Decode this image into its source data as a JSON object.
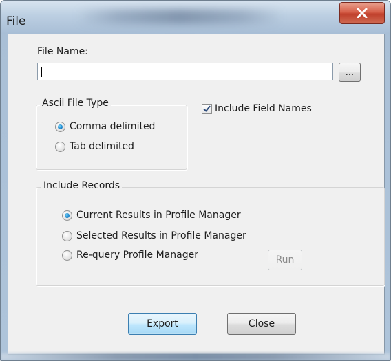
{
  "window": {
    "title": "File",
    "close_glyph": "X"
  },
  "file_name": {
    "label": "File Name:",
    "value": "",
    "browse_label": "..."
  },
  "ascii_file_type": {
    "label": "Ascii File Type",
    "options": [
      {
        "label": "Comma delimited",
        "selected": true
      },
      {
        "label": "Tab delimited",
        "selected": false
      }
    ]
  },
  "include_field_names": {
    "label": "Include Field Names",
    "checked": true
  },
  "include_records": {
    "label": "Include Records",
    "options": [
      {
        "label": "Current Results in Profile Manager",
        "selected": true
      },
      {
        "label": "Selected Results in Profile Manager",
        "selected": false
      },
      {
        "label": "Re-query Profile Manager",
        "selected": false
      }
    ],
    "run_label": "Run"
  },
  "buttons": {
    "export_label": "Export",
    "close_label": "Close"
  },
  "colors": {
    "accent": "#1f8ad0",
    "close_button": "#c0402c",
    "default_button_border": "#3c7fb1"
  },
  "icons": {
    "close": "close-icon",
    "check": "check-icon",
    "radio": "radio-dot"
  }
}
